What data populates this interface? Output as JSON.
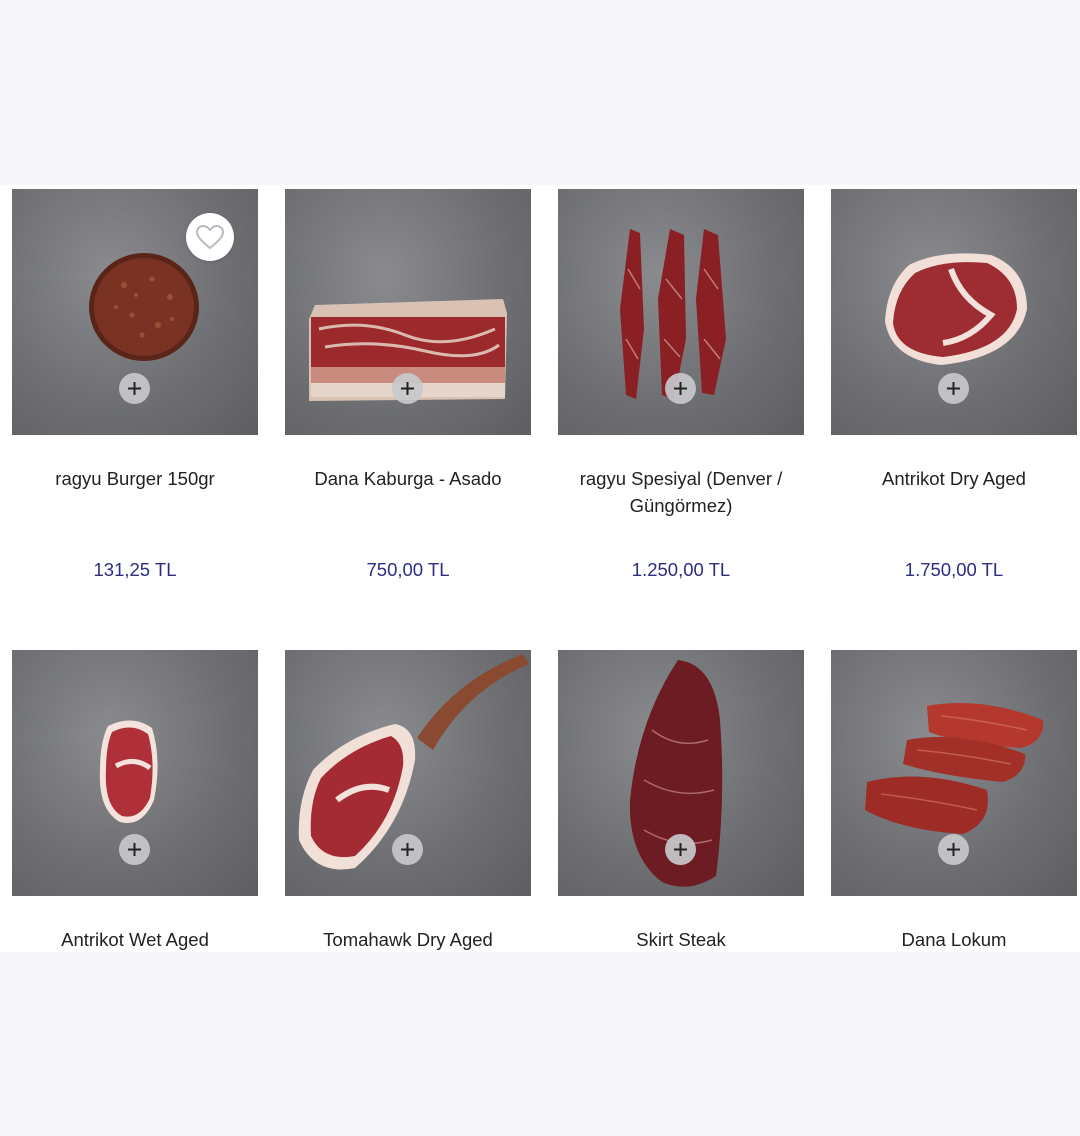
{
  "products": [
    {
      "name": "ragyu Burger 150gr",
      "price": "131,25 TL",
      "favorite": true
    },
    {
      "name": "Dana Kaburga - Asado",
      "price": "750,00 TL",
      "favorite": false
    },
    {
      "name": "ragyu Spesiyal (Denver / Güngörmez)",
      "price": "1.250,00 TL",
      "favorite": false
    },
    {
      "name": "Antrikot Dry Aged",
      "price": "1.750,00 TL",
      "favorite": false
    },
    {
      "name": "Antrikot Wet Aged",
      "price": "",
      "favorite": false
    },
    {
      "name": "Tomahawk Dry Aged",
      "price": "",
      "favorite": false
    },
    {
      "name": "Skirt Steak",
      "price": "",
      "favorite": false
    },
    {
      "name": "Dana Lokum",
      "price": "",
      "favorite": false
    }
  ],
  "icons": {
    "add": "plus-icon",
    "favorite": "heart-outline-icon"
  },
  "colors": {
    "price": "#2b2e83",
    "background": "#f7f7fa",
    "photo_bg": "#6f7074"
  }
}
